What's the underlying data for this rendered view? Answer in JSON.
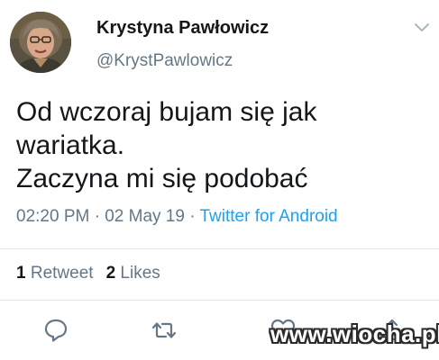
{
  "author": {
    "name": "Krystyna Pawłowicz",
    "handle": "@KrystPawlowicz"
  },
  "tweet": {
    "lines": [
      "Od wczoraj bujam się jak",
      "wariatka.",
      "Zaczyna mi się podobać"
    ],
    "time": "02:20 PM",
    "separator1": " · ",
    "date": "02 May 19",
    "separator2": " · ",
    "source": "Twitter for Android"
  },
  "stats": {
    "retweets_count": "1",
    "retweets_label": "Retweet",
    "likes_count": "2",
    "likes_label": "Likes"
  },
  "actions": {
    "reply_icon": "reply-icon",
    "retweet_icon": "retweet-icon",
    "like_icon": "heart-icon",
    "share_icon": "share-icon"
  },
  "watermark": "www.wiocha.pl",
  "colors": {
    "text": "#14171a",
    "secondary": "#657786",
    "link": "#1da1f2",
    "divider": "#e1e8ed"
  }
}
